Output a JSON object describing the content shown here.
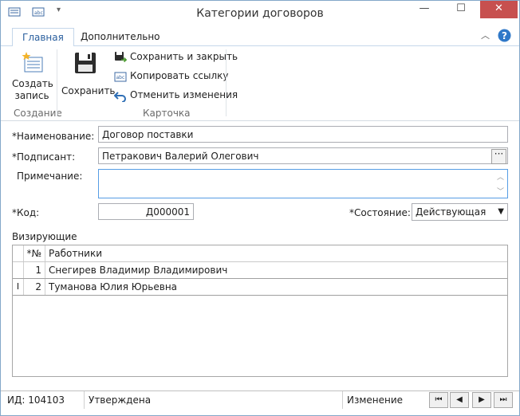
{
  "window": {
    "title": "Категории договоров",
    "minimize": "—",
    "maximize": "☐",
    "close": "✕"
  },
  "tabs": [
    {
      "label": "Главная"
    },
    {
      "label": "Дополнительно"
    }
  ],
  "ribbon": {
    "create_label_line1": "Создать",
    "create_label_line2": "запись",
    "group_create": "Создание",
    "save_label": "Сохранить",
    "save_close_label": "Сохранить и закрыть",
    "copy_link_label": "Копировать ссылку",
    "cancel_changes_label": "Отменить изменения",
    "group_card": "Карточка",
    "help": "?"
  },
  "form": {
    "name_label": "*Наименование:",
    "name_value": "Договор поставки",
    "signer_label": "*Подписант:",
    "signer_value": "Петракович Валерий Олегович",
    "signer_button": "···",
    "note_label": "Примечание:",
    "note_value": "",
    "code_label": "*Код:",
    "code_value": "Д000001",
    "state_label": "*Состояние:",
    "state_value": "Действующая"
  },
  "approvers": {
    "label": "Визирующие",
    "columns": {
      "num": "*№",
      "name": "Работники"
    },
    "rows": [
      {
        "num": "1",
        "name": "Снегирев Владимир Владимирович"
      },
      {
        "num": "2",
        "name": "Туманова Юлия Юрьевна"
      }
    ],
    "selected_row_marker": "I"
  },
  "status": {
    "id": "ИД: 104103",
    "state": "Утверждена",
    "action": "Изменение"
  }
}
